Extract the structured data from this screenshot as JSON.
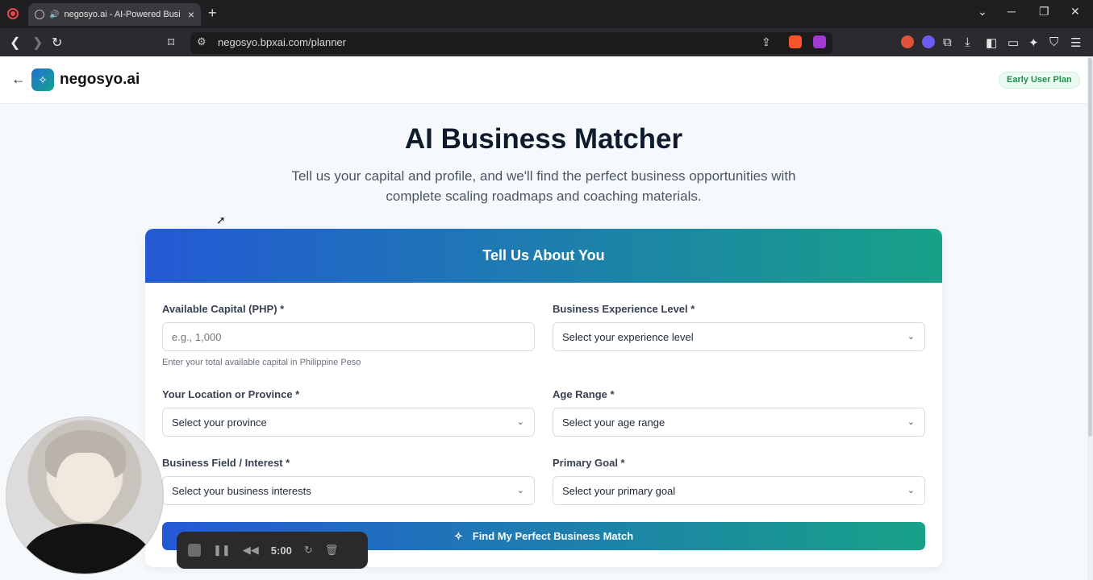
{
  "browser": {
    "tab_title": "negosyo.ai - AI-Powered Busi",
    "url": "negosyo.bpxai.com/planner",
    "new_tab": "+",
    "close_tab": "×"
  },
  "app": {
    "brand": "negosyo.ai",
    "plan_badge": "Early User Plan"
  },
  "hero": {
    "title": "AI Business Matcher",
    "subtitle": "Tell us your capital and profile, and we'll find the perfect business opportunities with complete scaling roadmaps and coaching materials."
  },
  "form": {
    "header": "Tell Us About You",
    "capital_label": "Available Capital (PHP) *",
    "capital_placeholder": "e.g., 1,000",
    "capital_hint": "Enter your total available capital in Philippine Peso",
    "experience_label": "Business Experience Level *",
    "experience_value": "Select your experience level",
    "location_label": "Your Location or Province *",
    "location_value": "Select your province",
    "age_label": "Age Range *",
    "age_value": "Select your age range",
    "interest_label": "Business Field / Interest *",
    "interest_value": "Select your business interests",
    "goal_label": "Primary Goal *",
    "goal_value": "Select your primary goal",
    "submit_label": "Find My Perfect Business Match"
  },
  "recorder": {
    "time": "5:00"
  },
  "icons": [
    "record-icon",
    "globe-icon",
    "speaker-icon",
    "close-icon",
    "back-icon",
    "forward-icon",
    "reload-icon",
    "bookmark-icon",
    "site-settings-icon",
    "share-icon",
    "brave-shield-icon",
    "brave-rewards-icon",
    "extensions-icon",
    "download-icon",
    "sidebar-icon",
    "wallet-icon",
    "leo-icon",
    "vpn-icon",
    "menu-icon",
    "sparkle-icon",
    "chevron-down-icon"
  ]
}
